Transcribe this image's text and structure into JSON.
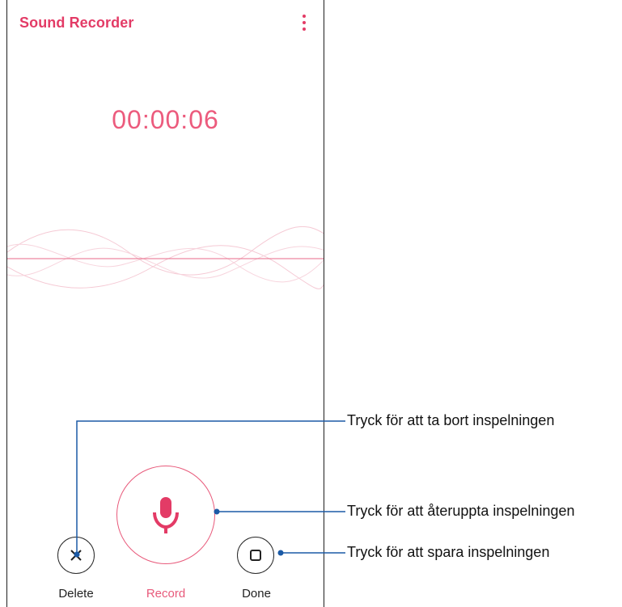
{
  "app": {
    "title": "Sound Recorder",
    "menu_icon": "more-vert-icon",
    "accent_color": "#e33b66"
  },
  "timer": "00:00:06",
  "controls": {
    "delete_label": "Delete",
    "record_label": "Record",
    "done_label": "Done",
    "delete_icon": "close-icon",
    "record_icon": "microphone-icon",
    "done_icon": "stop-icon"
  },
  "callouts": {
    "delete": "Tryck för att ta bort inspelningen",
    "record": "Tryck för att återuppta inspelningen",
    "done": "Tryck för att spara inspelningen",
    "line_color": "#1b5aa6"
  }
}
